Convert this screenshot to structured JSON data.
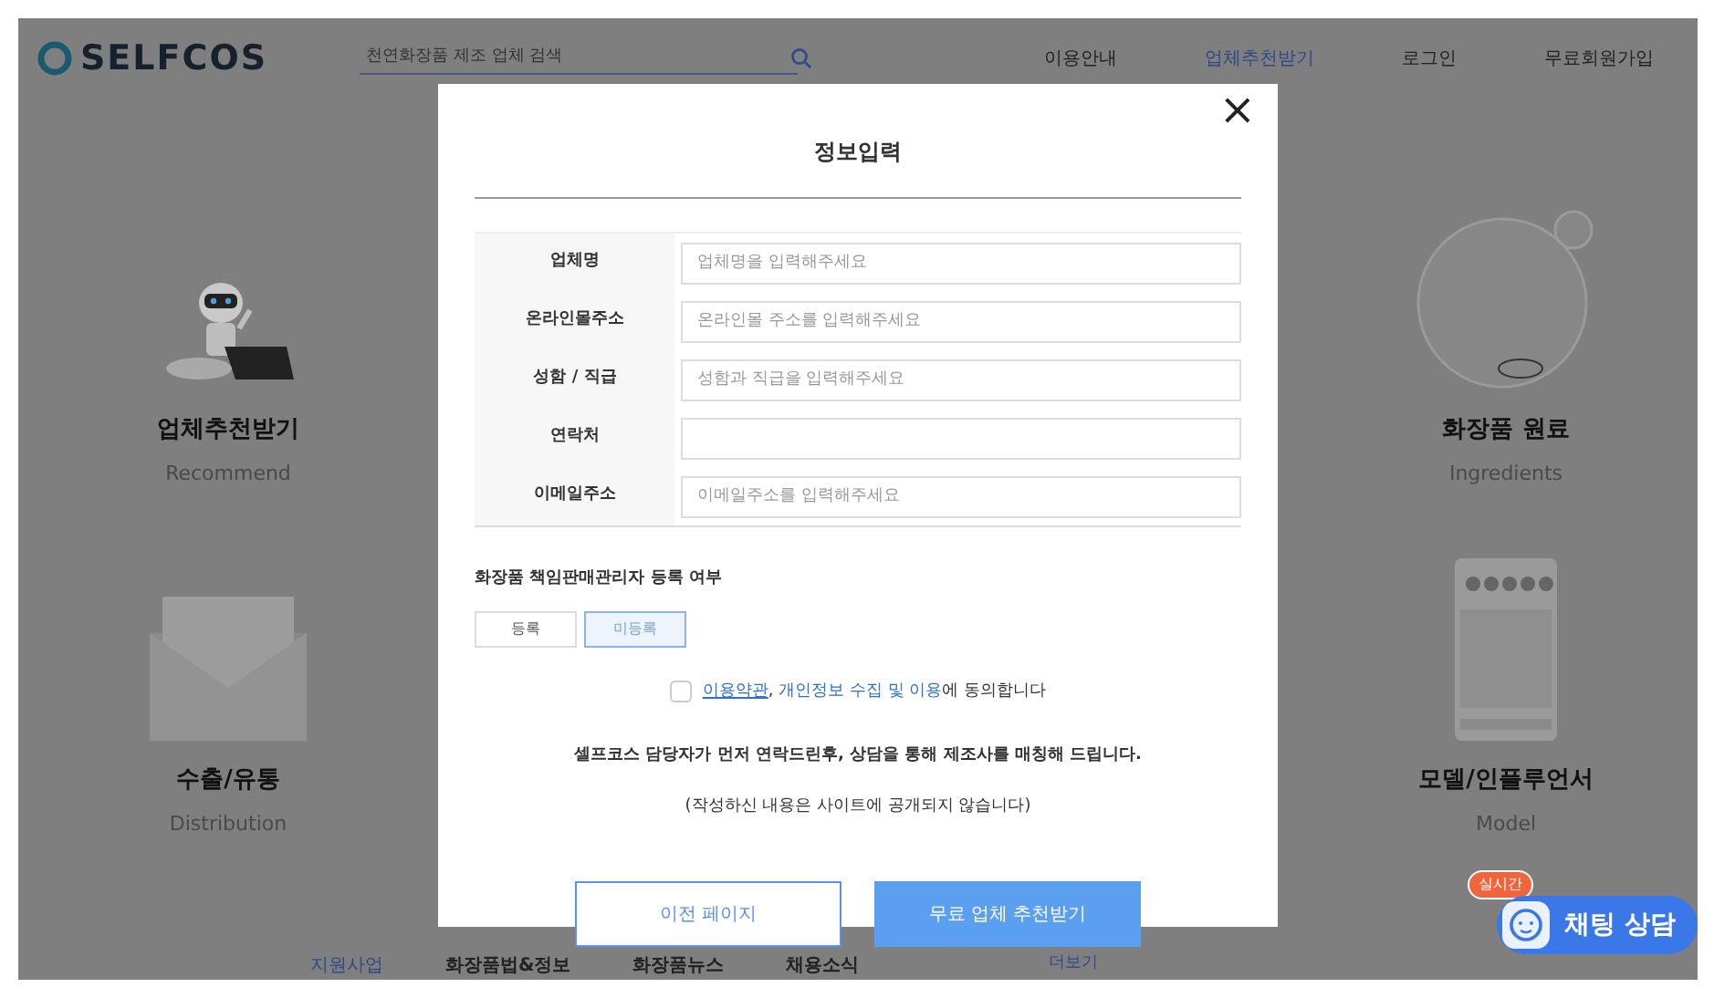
{
  "header": {
    "logo": "SELFCOS",
    "search": {
      "placeholder": "천연화장품 제조 업체 검색"
    },
    "nav": [
      {
        "label": "이용안내",
        "selected": false
      },
      {
        "label": "업체추천받기",
        "selected": true
      },
      {
        "label": "로그인",
        "selected": false
      },
      {
        "label": "무료회원가입",
        "selected": false
      }
    ]
  },
  "features": [
    {
      "kind": "robot",
      "title": "업체추천받기",
      "subtitle": "Recommend"
    },
    {
      "kind": "envelope",
      "title": "수출/유통",
      "subtitle": "Distribution"
    },
    {
      "kind": "bubble",
      "title": "화장품 원료",
      "subtitle": "Ingredients"
    },
    {
      "kind": "phone",
      "title": "모델/인플루언서",
      "subtitle": "Model"
    }
  ],
  "footer_menu": [
    {
      "label": "지원사업",
      "selected": true
    },
    {
      "label": "화장품법&정보",
      "selected": false
    },
    {
      "label": "화장품뉴스",
      "selected": false
    },
    {
      "label": "채용소식",
      "selected": false
    }
  ],
  "footer_more": "더보기",
  "modal": {
    "title": "정보입력",
    "close": "×",
    "fields": [
      {
        "label": "업체명",
        "placeholder": "업체명을 입력해주세요"
      },
      {
        "label": "온라인몰주소",
        "placeholder": "온라인몰 주소를 입력해주세요"
      },
      {
        "label": "성함 / 직급",
        "placeholder": "성함과 직급을 입력해주세요"
      },
      {
        "label": "연락처"
      },
      {
        "label": "이메일주소",
        "placeholder": "이메일주소를 입력해주세요"
      }
    ],
    "registration": {
      "label": "화장품 책임판매관리자 등록 여부",
      "options": [
        {
          "label": "등록",
          "selected": false
        },
        {
          "label": "미등록",
          "selected": true
        }
      ]
    },
    "agreement": {
      "checked": false,
      "links": [
        "이용약관",
        "개인정보 수집 및 이용"
      ],
      "separator": ", ",
      "text": "에 동의합니다"
    },
    "notes": [
      "셀프코스 담당자가 먼저 연락드린후, 상담을 통해 제조사를 매칭해 드립니다.",
      "(작성하신 내용은 사이트에 공개되지 않습니다)"
    ],
    "buttons": [
      {
        "label": "이전 페이지",
        "kind": "secondary"
      },
      {
        "label": "무료 업체 추천받기",
        "kind": "primary"
      }
    ]
  },
  "chat": {
    "badge": "실시간",
    "label": "채팅 상담"
  }
}
